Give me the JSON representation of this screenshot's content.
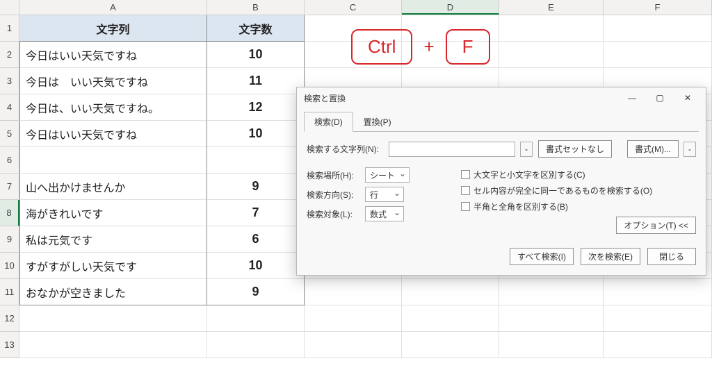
{
  "columns": [
    "A",
    "B",
    "C",
    "D",
    "E",
    "F"
  ],
  "active_column": "D",
  "active_row": 8,
  "table": {
    "headers": {
      "col_a": "文字列",
      "col_b": "文字数"
    },
    "rows": [
      {
        "text": "今日はいい天気ですね",
        "count": "10"
      },
      {
        "text": "今日は　いい天気ですね",
        "count": "11"
      },
      {
        "text": "今日は、いい天気ですね。",
        "count": "12"
      },
      {
        "text": "今日はいい天気ですね",
        "count": "10"
      },
      {
        "text": "",
        "count": ""
      },
      {
        "text": "山へ出かけませんか",
        "count": "9"
      },
      {
        "text": "海がきれいです",
        "count": "7"
      },
      {
        "text": "私は元気です",
        "count": "6"
      },
      {
        "text": "すがすがしい天気です",
        "count": "10"
      },
      {
        "text": "おなかが空きました",
        "count": "9"
      }
    ]
  },
  "annotation": {
    "key1": "Ctrl",
    "plus": "+",
    "key2": "F"
  },
  "dialog": {
    "title": "検索と置換",
    "tabs": {
      "find": "検索(D)",
      "replace": "置換(P)"
    },
    "find_label": "検索する文字列(N):",
    "find_value": "",
    "btn_format_none": "書式セットなし",
    "btn_format": "書式(M)...",
    "scope_label": "検索場所(H):",
    "scope_value": "シート",
    "direction_label": "検索方向(S):",
    "direction_value": "行",
    "target_label": "検索対象(L):",
    "target_value": "数式",
    "chk_case": "大文字と小文字を区別する(C)",
    "chk_exact": "セル内容が完全に同一であるものを検索する(O)",
    "chk_width": "半角と全角を区別する(B)",
    "btn_options": "オプション(T) <<",
    "btn_find_all": "すべて検索(I)",
    "btn_find_next": "次を検索(E)",
    "btn_close": "閉じる"
  }
}
